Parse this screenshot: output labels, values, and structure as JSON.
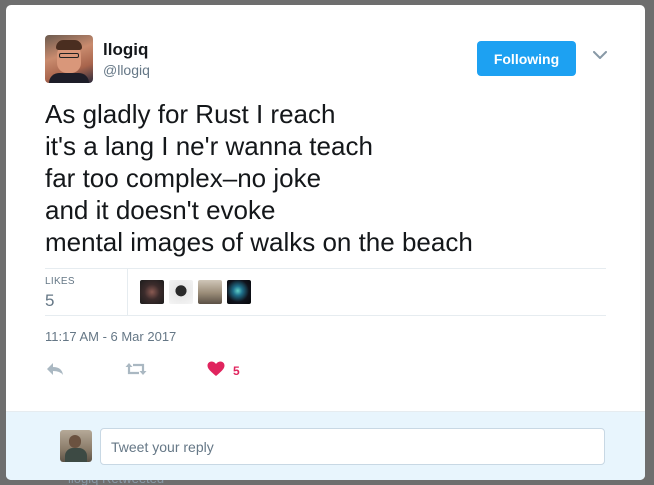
{
  "tweet": {
    "author": {
      "display_name": "llogiq",
      "screen_name": "@llogiq"
    },
    "follow_button_label": "Following",
    "text_lines": [
      "As gladly for Rust I reach",
      "it's a lang I ne'r wanna teach",
      "far too complex–no joke",
      "and it doesn't evoke",
      "mental images of walks on the beach"
    ],
    "stats": {
      "likes_label": "LIKES",
      "likes_count": "5"
    },
    "timestamp": "11:17 AM - 6 Mar 2017",
    "actions": {
      "like_count": "5"
    }
  },
  "reply": {
    "placeholder": "Tweet your reply"
  },
  "background_text": "llogiq Retweeted",
  "colors": {
    "accent": "#1da1f2",
    "like": "#e0245e",
    "muted": "#657786"
  },
  "icons": [
    "chevron-down-icon",
    "reply-icon",
    "retweet-icon",
    "heart-icon"
  ]
}
